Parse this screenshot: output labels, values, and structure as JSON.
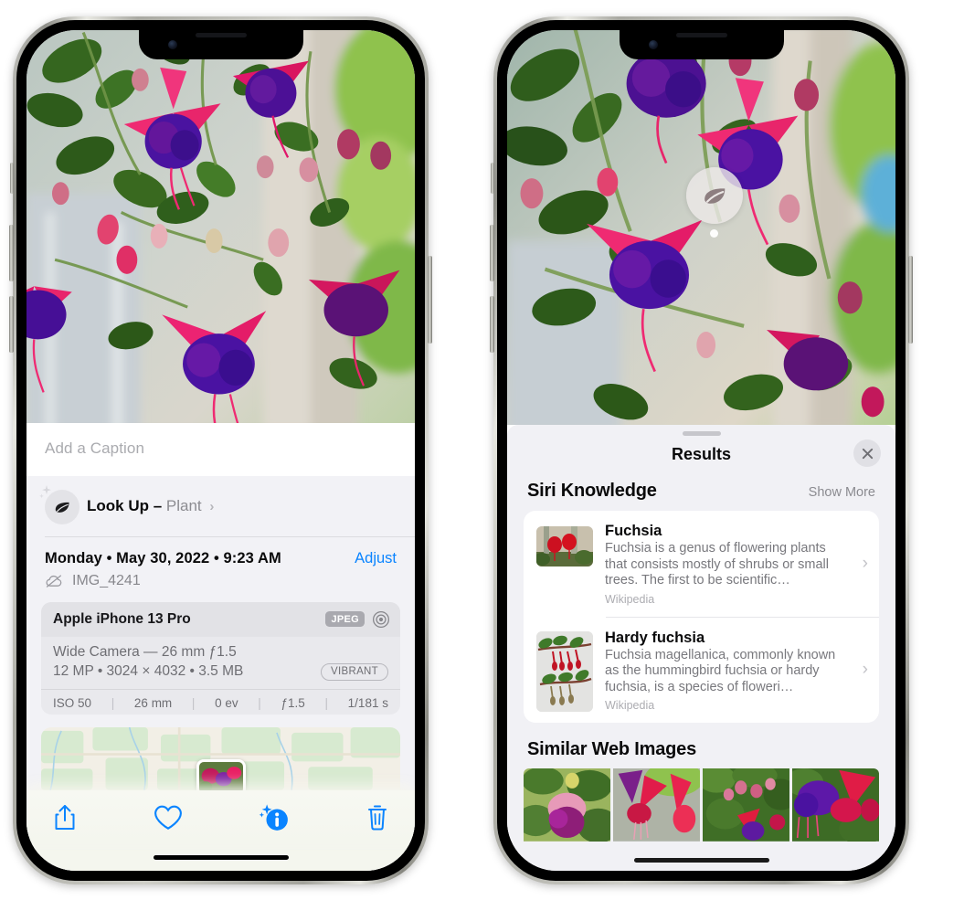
{
  "left_phone": {
    "caption_placeholder": "Add a Caption",
    "lookup": {
      "icon": "leaf-icon",
      "label": "Look Up –",
      "subject": "Plant",
      "chevron": "›"
    },
    "date_line": "Monday • May 30, 2022 • 9:23 AM",
    "adjust_label": "Adjust",
    "cloud_icon": "cloud-slash-icon",
    "filename": "IMG_4241",
    "exif": {
      "device": "Apple iPhone 13 Pro",
      "format_badge": "JPEG",
      "aperture_icon": "lens-icon",
      "lens_line": "Wide Camera — 26 mm ƒ1.5",
      "specs_line": "12 MP • 3024 × 4032 • 3.5 MB",
      "style_badge": "VIBRANT",
      "stats": [
        "ISO 50",
        "26 mm",
        "0 ev",
        "ƒ1.5",
        "1/181 s"
      ]
    },
    "toolbar": [
      {
        "name": "share-icon",
        "label": "Share"
      },
      {
        "name": "heart-icon",
        "label": "Favorite"
      },
      {
        "name": "info-icon",
        "label": "Info"
      },
      {
        "name": "trash-icon",
        "label": "Delete"
      }
    ]
  },
  "right_phone": {
    "visual_lookup_badge": "leaf-icon",
    "sheet": {
      "title": "Results",
      "close_icon": "close-icon",
      "siri_knowledge": {
        "heading": "Siri Knowledge",
        "show_more": "Show More",
        "items": [
          {
            "title": "Fuchsia",
            "description": "Fuchsia is a genus of flowering plants that consists mostly of shrubs or small trees. The first to be scientific…",
            "source": "Wikipedia",
            "chevron": "›"
          },
          {
            "title": "Hardy fuchsia",
            "description": "Fuchsia magellanica, commonly known as the hummingbird fuchsia or hardy fuchsia, is a species of floweri…",
            "source": "Wikipedia",
            "chevron": "›"
          }
        ]
      },
      "similar_web_images": {
        "heading": "Similar Web Images",
        "tiles": [
          "fuchsia-pink-bloom",
          "fuchsia-red-closeup",
          "fuchsia-bush",
          "fuchsia-purple-bloom"
        ]
      }
    }
  },
  "colors": {
    "accent_blue": "#0a84ff",
    "sheet_bg": "#f1f1f5",
    "card_bg": "#ffffff",
    "muted_text": "#78787d"
  }
}
